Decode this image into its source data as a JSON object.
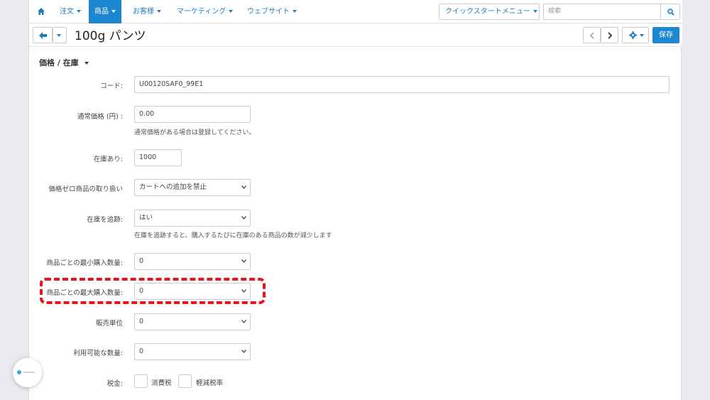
{
  "nav": {
    "items": [
      {
        "label": "注文"
      },
      {
        "label": "商品"
      },
      {
        "label": "お客様"
      },
      {
        "label": "マーケティング"
      },
      {
        "label": "ウェブサイト"
      }
    ],
    "quickstart_label": "クイックスタートメニュー",
    "search_placeholder": "検索"
  },
  "toolbar": {
    "title": "100g パンツ",
    "save_label": "保存"
  },
  "section": {
    "title": "価格 / 在庫"
  },
  "form": {
    "code": {
      "label": "コード:",
      "value": "U00120SAF0_99E1"
    },
    "list_price": {
      "label": "通常価格 (円) :",
      "value": "0.00",
      "help": "通常価格がある場合は登録してください。"
    },
    "in_stock": {
      "label": "在庫あり:",
      "value": "1000"
    },
    "zero_price": {
      "label": "価格ゼロ商品の取り扱い",
      "value": "カートへの追加を禁止"
    },
    "track_inventory": {
      "label": "在庫を追跡:",
      "value": "はい",
      "help": "在庫を追跡すると、購入するたびに在庫のある商品の数が減少します"
    },
    "min_qty": {
      "label": "商品ごとの最小購入数量:",
      "value": "0"
    },
    "max_qty": {
      "label": "商品ごとの最大購入数量:",
      "value": "0"
    },
    "qty_step": {
      "label": "販売単位",
      "value": "0"
    },
    "list_qty": {
      "label": "利用可能な数量:",
      "value": "0"
    },
    "taxes": {
      "label": "税金:",
      "options": [
        "消費税",
        "軽減税率"
      ]
    }
  },
  "colors": {
    "accent": "#1a87d0",
    "highlight": "#e8141c"
  }
}
